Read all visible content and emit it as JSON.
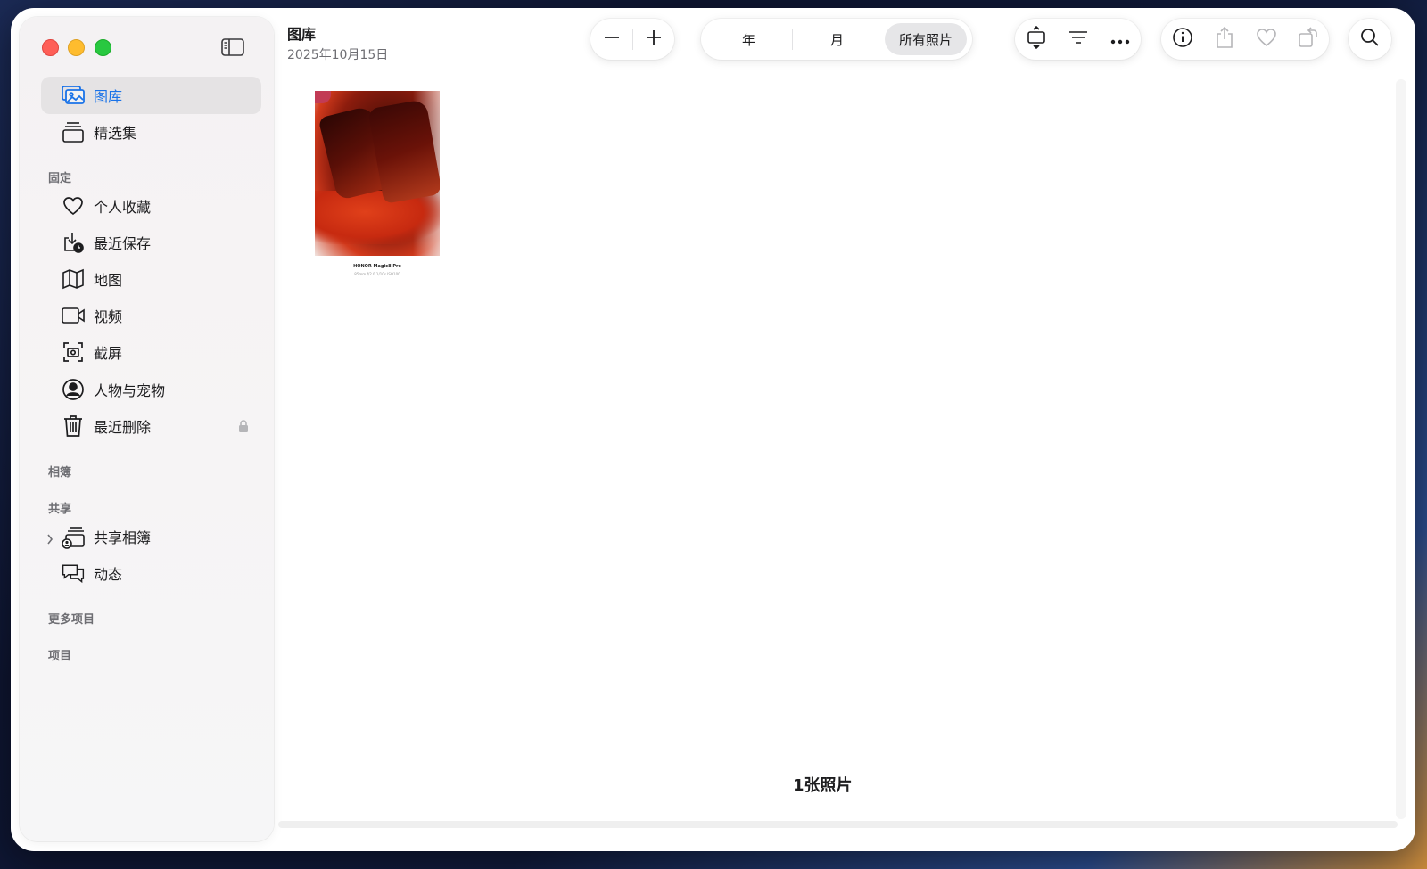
{
  "window": {
    "title": "图库",
    "date": "2025年10月15日"
  },
  "sidebar": {
    "items": [
      {
        "label": "图库",
        "icon": "photo-library-icon",
        "selected": true
      },
      {
        "label": "精选集",
        "icon": "collections-stack-icon"
      }
    ],
    "pinned_header": "固定",
    "pinned": [
      {
        "label": "个人收藏",
        "icon": "heart-icon"
      },
      {
        "label": "最近保存",
        "icon": "recently-saved-icon"
      },
      {
        "label": "地图",
        "icon": "map-icon"
      },
      {
        "label": "视频",
        "icon": "video-icon"
      },
      {
        "label": "截屏",
        "icon": "screenshot-icon"
      },
      {
        "label": "人物与宠物",
        "icon": "person-circle-icon"
      },
      {
        "label": "最近删除",
        "icon": "trash-icon"
      }
    ],
    "albums_header": "相簿",
    "shared_header": "共享",
    "shared": [
      {
        "label": "共享相簿",
        "icon": "shared-album-icon"
      },
      {
        "label": "动态",
        "icon": "activity-bubbles-icon"
      }
    ],
    "more_header": "更多项目",
    "projects_header": "项目"
  },
  "toolbar": {
    "zoom_out": "zoom-out-minus-icon",
    "zoom_in": "zoom-in-plus-icon",
    "views": [
      "年",
      "月",
      "所有照片"
    ],
    "active_view": "所有照片"
  },
  "content": {
    "photo_caption_line1": "HONOR Magic8 Pro",
    "photo_caption_line2": "85mm f/2.0 1/10s ISO100",
    "count_label": "1张照片"
  },
  "colors": {
    "accent": "#1a73e8",
    "traffic_red": "#fe5f57",
    "traffic_yellow": "#febc2e",
    "traffic_green": "#28c840"
  }
}
